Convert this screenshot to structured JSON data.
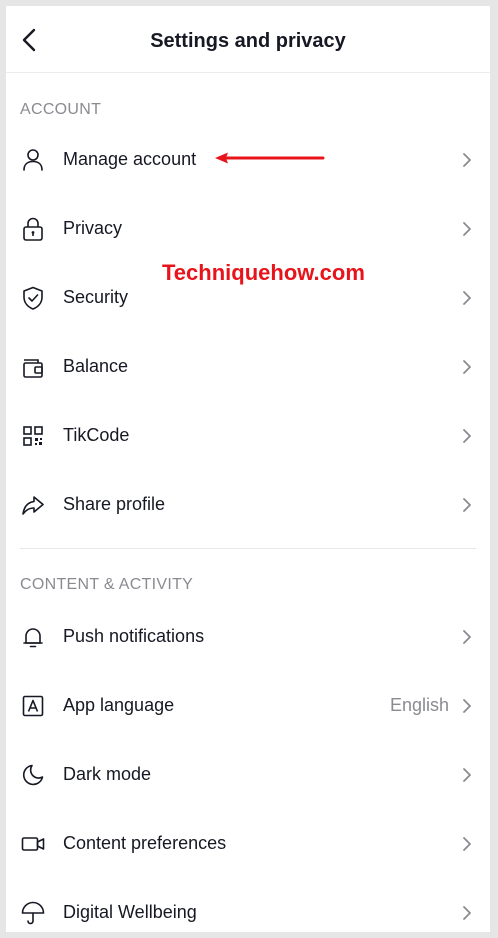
{
  "header": {
    "title": "Settings and privacy"
  },
  "sections": {
    "account": {
      "title": "ACCOUNT",
      "items": [
        {
          "label": "Manage account"
        },
        {
          "label": "Privacy"
        },
        {
          "label": "Security"
        },
        {
          "label": "Balance"
        },
        {
          "label": "TikCode"
        },
        {
          "label": "Share profile"
        }
      ]
    },
    "content": {
      "title": "CONTENT & ACTIVITY",
      "items": [
        {
          "label": "Push notifications"
        },
        {
          "label": "App language",
          "value": "English"
        },
        {
          "label": "Dark mode"
        },
        {
          "label": "Content preferences"
        },
        {
          "label": "Digital Wellbeing"
        }
      ]
    }
  },
  "watermark": "Techniquehow.com",
  "colors": {
    "annotation_red": "#e8141b",
    "text_primary": "#161823",
    "text_secondary": "#8a8b91"
  },
  "icons": {
    "back": "chevron-left-icon",
    "manage_account": "person-icon",
    "privacy": "lock-icon",
    "security": "shield-icon",
    "balance": "wallet-icon",
    "tikcode": "qr-code-icon",
    "share_profile": "share-arrow-icon",
    "push_notifications": "bell-icon",
    "app_language": "language-icon",
    "dark_mode": "moon-icon",
    "content_preferences": "video-camera-icon",
    "digital_wellbeing": "umbrella-icon"
  }
}
